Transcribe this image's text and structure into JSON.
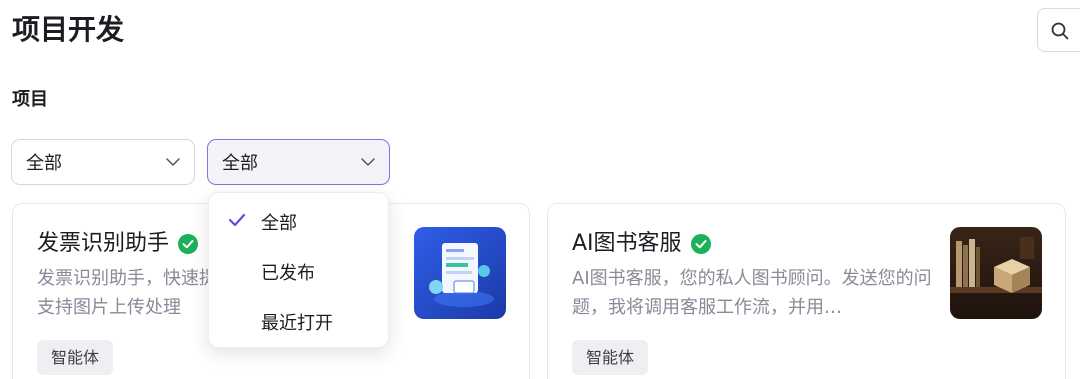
{
  "header": {
    "title": "项目开发",
    "search_icon": "search-icon"
  },
  "section": {
    "label": "项目"
  },
  "filters": [
    {
      "value": "全部"
    },
    {
      "value": "全部"
    }
  ],
  "dropdown": {
    "items": [
      {
        "label": "全部",
        "selected": true
      },
      {
        "label": "已发布",
        "selected": false
      },
      {
        "label": "最近打开",
        "selected": false
      }
    ],
    "accent": "#5b4fe0"
  },
  "cards": [
    {
      "title": "发票识别助手",
      "desc": "发票识别助手，快速提取发票中的关键信息，支持图片上传处理",
      "tag": "智能体",
      "status_color": "#1bb15a"
    },
    {
      "title": "AI图书客服",
      "desc": "AI图书客服，您的私人图书顾问。发送您的问题，我将调用客服工作流，并用…",
      "tag": "智能体",
      "status_color": "#1bb15a"
    }
  ]
}
